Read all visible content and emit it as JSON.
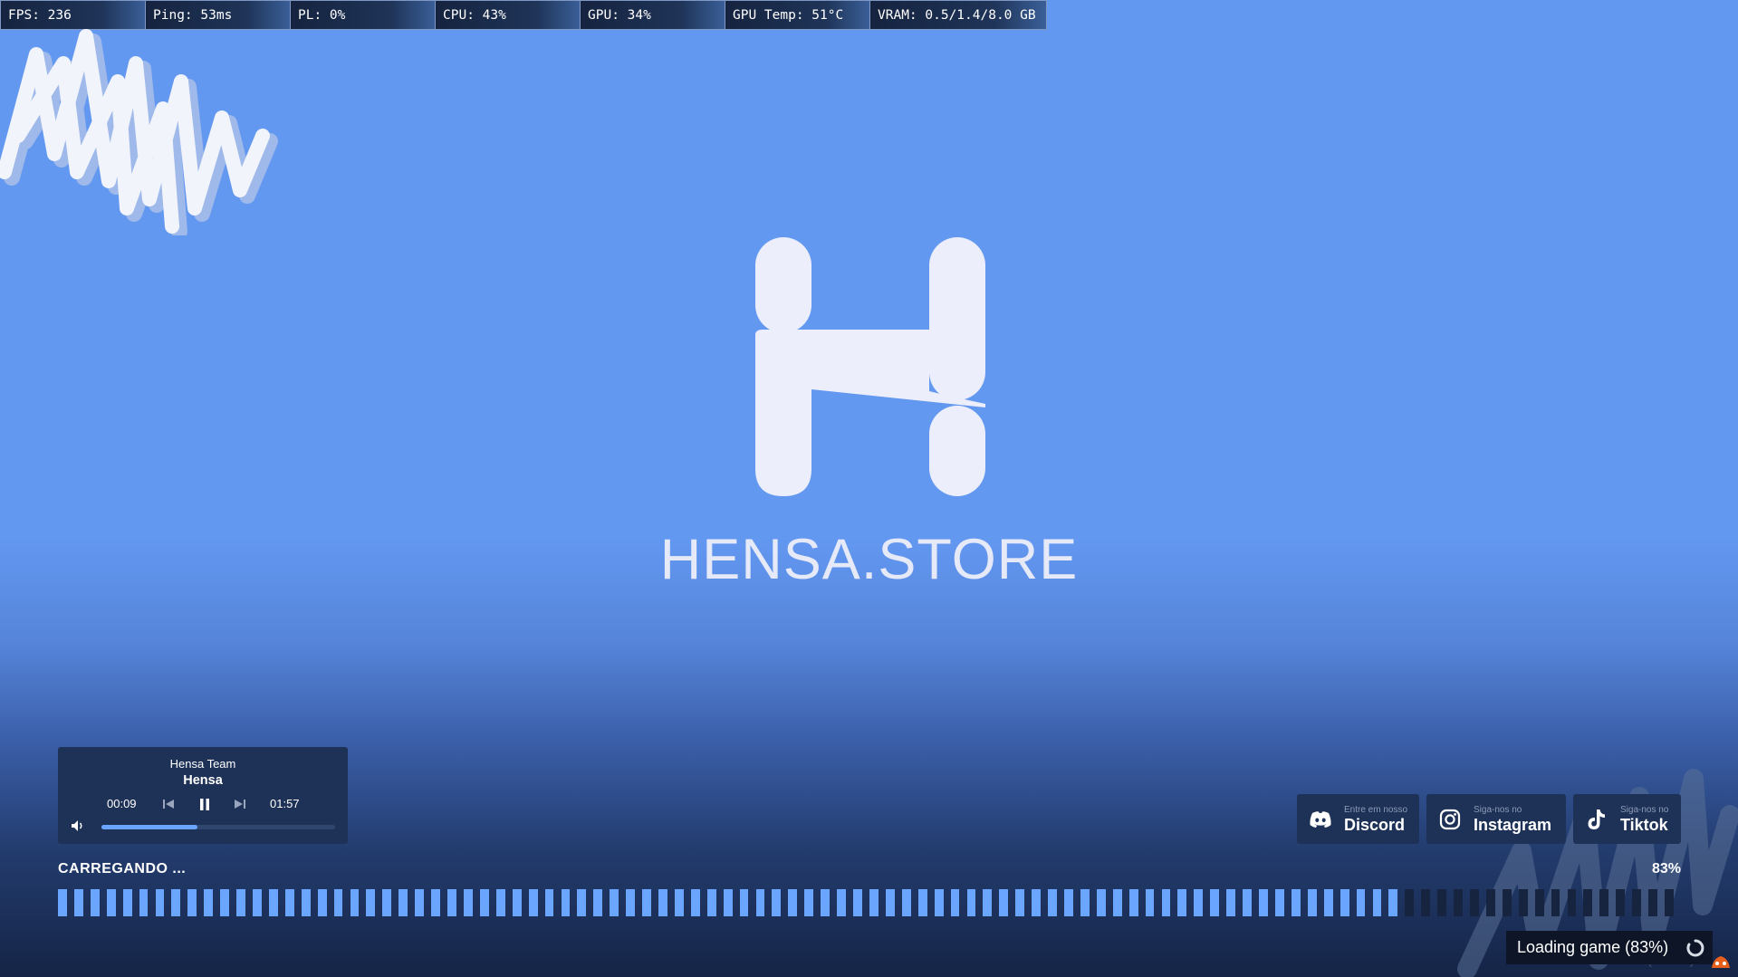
{
  "perf_overlay": {
    "fps": "FPS: 236",
    "ping": "Ping: 53ms",
    "pl": "PL: 0%",
    "cpu": "CPU: 43%",
    "gpu": "GPU: 34%",
    "gpu_temp": "GPU Temp: 51°C",
    "vram": "VRAM: 0.5/1.4/8.0 GB"
  },
  "logo": {
    "text": "HENSA.STORE"
  },
  "player": {
    "artist": "Hensa Team",
    "track": "Hensa",
    "current_time": "00:09",
    "total_time": "01:57",
    "progress": 0.41
  },
  "socials": {
    "discord": {
      "sub": "Entre em nosso",
      "main": "Discord",
      "icon": "discord-icon"
    },
    "instagram": {
      "sub": "Siga-nos no",
      "main": "Instagram",
      "icon": "instagram-icon"
    },
    "tiktok": {
      "sub": "Siga-nos no",
      "main": "Tiktok",
      "icon": "tiktok-icon"
    }
  },
  "loading": {
    "label": "CARREGANDO ...",
    "percent_text": "83%",
    "segments_total": 100,
    "progress": 0.83,
    "filled_color": "#6aa6ff",
    "empty_color": "#16243f"
  },
  "toast": {
    "text": "Loading game (83%)",
    "ghost": "FiveM (b3258)"
  },
  "colors": {
    "background": "#6398f1",
    "panel": "#1e3257",
    "accent": "#6aa6ff"
  }
}
